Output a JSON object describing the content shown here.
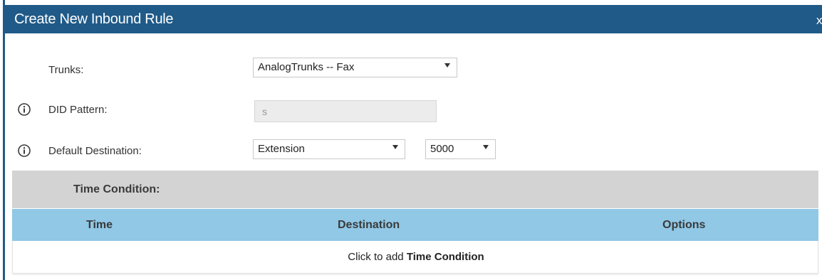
{
  "dialog": {
    "title": "Create New Inbound Rule",
    "close_label": "x"
  },
  "form": {
    "trunks": {
      "label": "Trunks:",
      "value": "AnalogTrunks -- Fax"
    },
    "did_pattern": {
      "label": "DID Pattern:",
      "value": "s"
    },
    "default_destination": {
      "label": "Default Destination:",
      "type_value": "Extension",
      "extension_value": "5000"
    }
  },
  "time_condition": {
    "title": "Time Condition:",
    "columns": [
      "Time",
      "Destination",
      "Options"
    ],
    "add_prefix": "Click to add ",
    "add_bold": "Time Condition"
  },
  "colors": {
    "titlebar": "#1f5a88",
    "table_header": "#90c8e6",
    "section_header": "#d3d3d3"
  },
  "icons": {
    "info": "info-icon",
    "dropdown": "chevron-down-icon",
    "close": "close-icon"
  }
}
